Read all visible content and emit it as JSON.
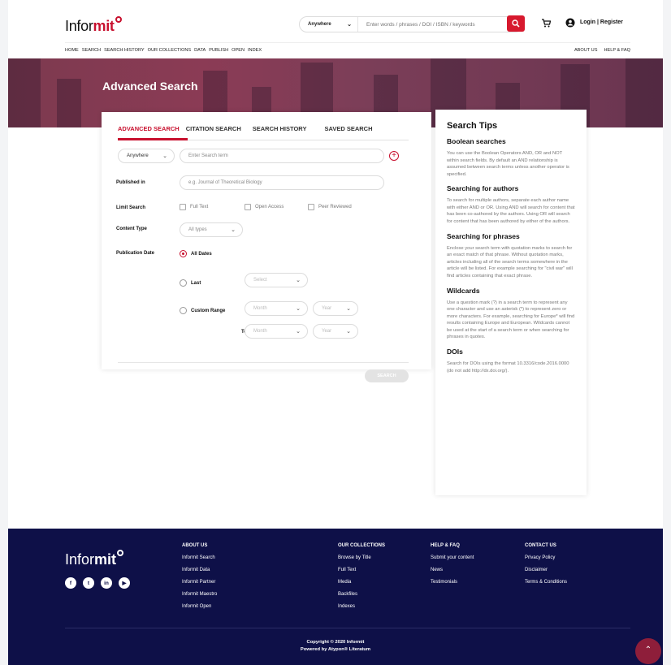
{
  "header": {
    "logo_plain": "Infor",
    "logo_bold": "mit",
    "search_scope": "Anywhere",
    "search_placeholder": "Enter words / phrases / DOI / ISBN / keywords",
    "login": "Login | Register"
  },
  "nav": {
    "left": [
      "HOME",
      "SEARCH",
      "SEARCH HISTORY",
      "OUR COLLECTIONS",
      "DATA",
      "PUBLISH",
      "OPEN",
      "INDEX"
    ],
    "right": [
      "ABOUT US",
      "HELP & FAQ"
    ]
  },
  "hero": {
    "title": "Advanced Search"
  },
  "tabs": [
    "ADVANCED SEARCH",
    "CITATION SEARCH",
    "SEARCH HISTORY",
    "SAVED SEARCH"
  ],
  "form": {
    "scope": "Anywhere",
    "term_placeholder": "Enter Search term",
    "published_in_label": "Published in",
    "published_in_placeholder": "e.g. Journal of Theoretical Biology",
    "limit_label": "Limit Search",
    "limit_options": [
      "Full Text",
      "Open Access",
      "Peer Reviewed"
    ],
    "content_type_label": "Content Type",
    "content_type_value": "All types",
    "pub_date_label": "Publication Date",
    "all_dates": "All Dates",
    "last": "Last",
    "last_select": "Select",
    "custom_range": "Custom Range",
    "month": "Month",
    "year": "Year",
    "to": "To",
    "submit": "SEARCH"
  },
  "tips": {
    "title": "Search Tips",
    "sections": [
      {
        "heading": "Boolean searches",
        "text": "You can use the Boolean Operators AND, OR and NOT within search fields. By default an AND relationship is assumed between search terms unless another operator is specified."
      },
      {
        "heading": "Searching for authors",
        "text": "To search for multiple authors, separate each author name with either AND or OR. Using AND will search for content that has been co-authored by the authors. Using OR will search for content that has been authored by either of the authors."
      },
      {
        "heading": "Searching for phrases",
        "text": "Enclose your search term with quotation marks to search for an exact match of that phrase. Without quotation marks, articles including all of the search terms somewhere in the article will be listed. For example searching for \"civil war\" will find articles containing that exact phrase."
      },
      {
        "heading": "Wildcards",
        "text": "Use a question mark (?) in a search term to represent any one character and use an asterisk (*) to represent zero or more characters. For example, searching for Europe* will find results containing Europe and European. Wildcards cannot be used at the start of a search term or when searching for phrases in quotes."
      },
      {
        "heading": "DOIs",
        "text": "Search for DOIs using the format 10.3316/code.2016.0000 (do not add http://dx.doi.org/)."
      }
    ]
  },
  "footer": {
    "logo_plain": "Infor",
    "logo_bold": "mit",
    "socials": [
      "f",
      "t",
      "in",
      "▶"
    ],
    "columns": [
      {
        "heading": "ABOUT US",
        "links": [
          "Informit Search",
          "Informit Data",
          "Informit Partner",
          "Informit Maestro",
          "Informit Open"
        ]
      },
      {
        "heading": "OUR COLLECTIONS",
        "links": [
          "Browse by Title",
          "Full Text",
          "Media",
          "Backfiles",
          "Indexes"
        ]
      },
      {
        "heading": "HELP & FAQ",
        "links": [
          "Submit your content",
          "News",
          "Testimonials"
        ]
      },
      {
        "heading": "CONTACT US",
        "links": [
          "Privacy Policy",
          "Disclaimer",
          "Terms & Conditions"
        ]
      }
    ],
    "copyright": "Copyright © 2020 Informit",
    "powered": "Powered by Atypon® Literatum"
  },
  "colors": {
    "brand_red": "#c8102e",
    "footer_navy": "#0e1048",
    "hero": "#7c3a4f"
  }
}
